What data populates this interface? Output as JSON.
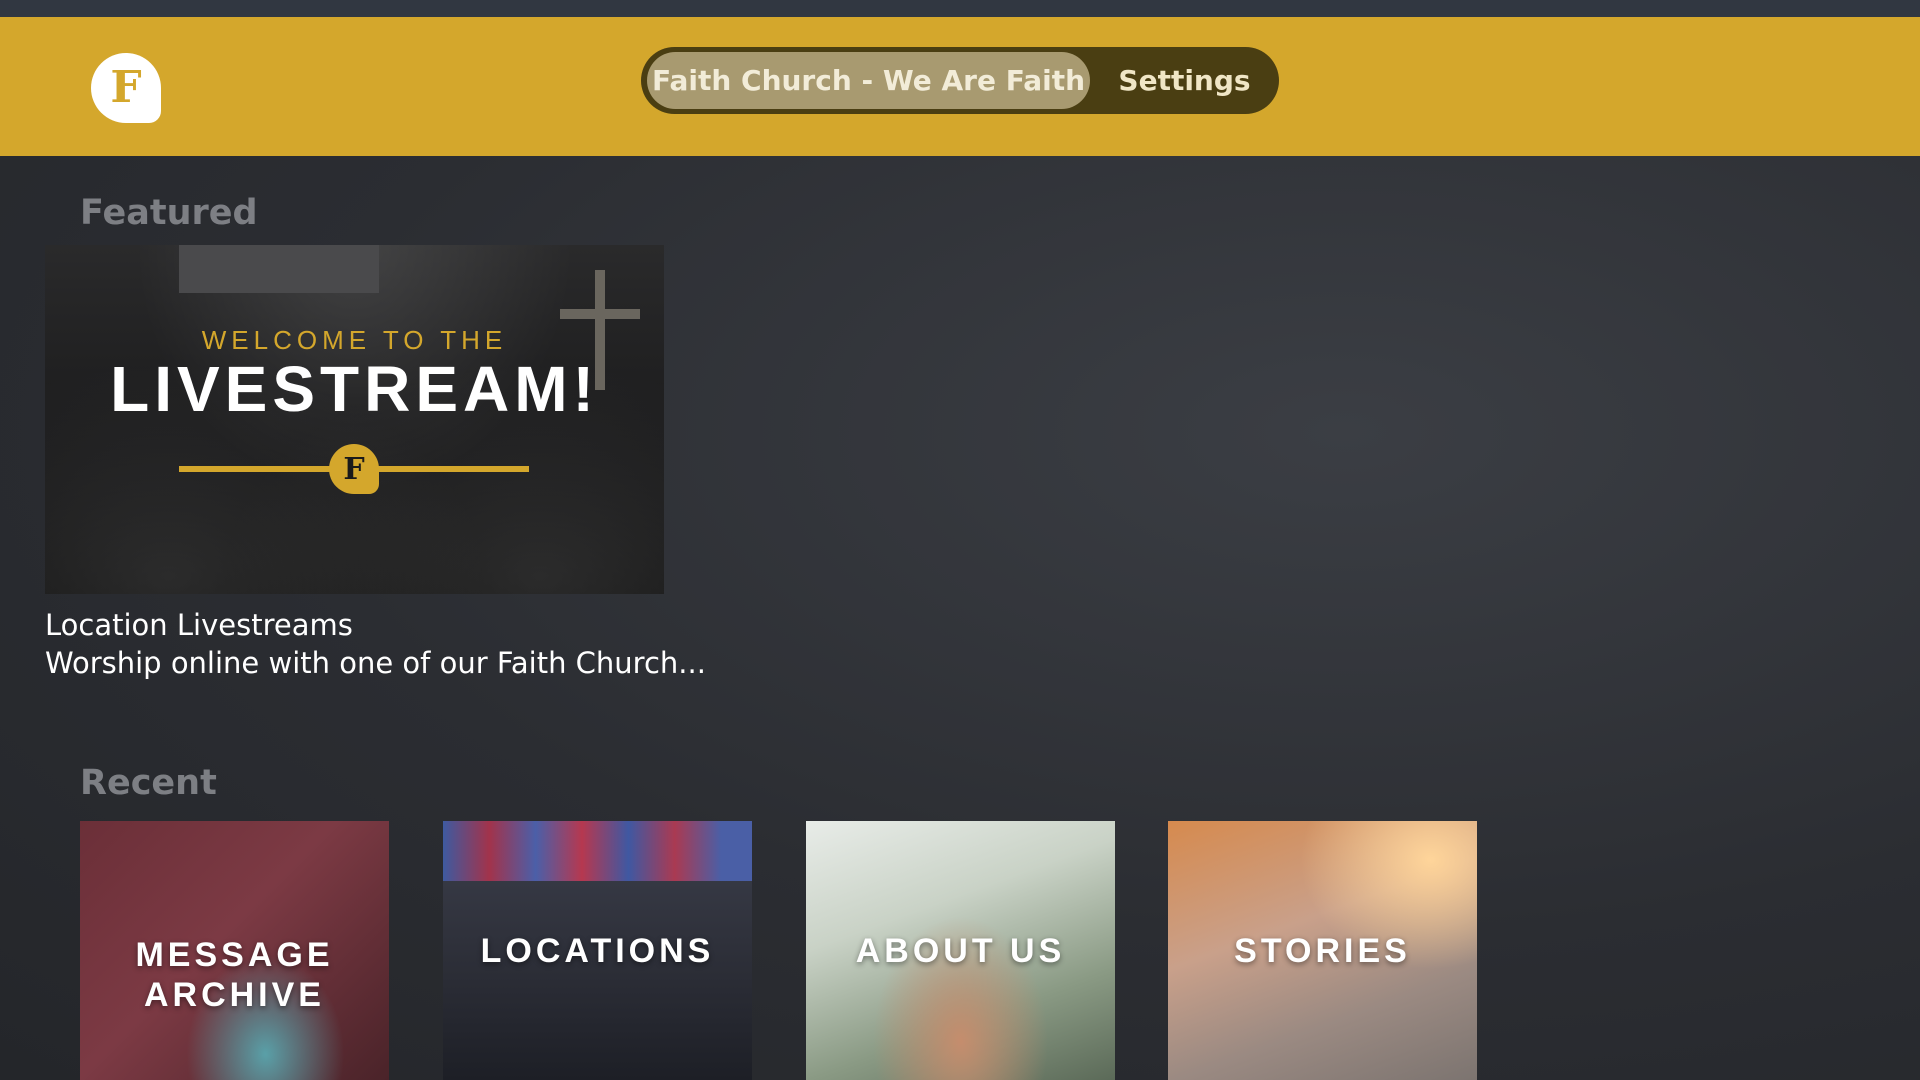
{
  "app": {
    "logo_letter": "F"
  },
  "nav": {
    "tabs": [
      {
        "label": "Faith Church - We Are Faith",
        "active": true
      },
      {
        "label": "Settings",
        "active": false
      }
    ]
  },
  "featured": {
    "section_title": "Featured",
    "card": {
      "banner_top": "WELCOME TO THE",
      "banner_main": "LIVESTREAM!",
      "badge_letter": "F",
      "title": "Location Livestreams",
      "description": "Worship online with one of our Faith Church..."
    }
  },
  "recent": {
    "section_title": "Recent",
    "tiles": [
      {
        "line1": "MESSAGE",
        "line2": "ARCHIVE"
      },
      {
        "line1": "LOCATIONS"
      },
      {
        "line1": "ABOUT US"
      },
      {
        "line1": "STORIES"
      }
    ]
  },
  "colors": {
    "header": "#d4a72c",
    "background": "#2b2d31",
    "tab_active": "#a89a70",
    "tab_bar": "#4a3e12"
  }
}
